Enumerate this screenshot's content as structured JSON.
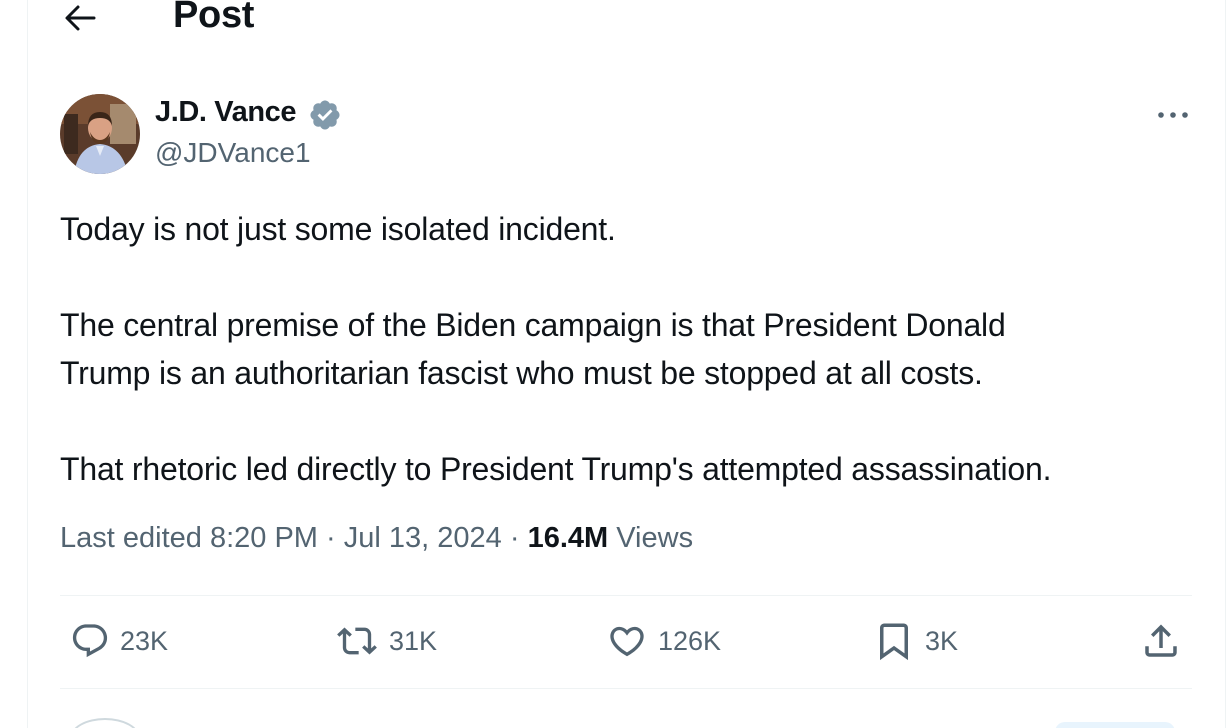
{
  "header": {
    "title": "Post",
    "back_icon": "arrow-left-icon"
  },
  "post": {
    "author": {
      "name": "J.D. Vance",
      "handle": "@JDVance1",
      "verified": true,
      "verified_color": "#829aab"
    },
    "text": {
      "line1": "Today is not just some isolated incident.",
      "line2": "The central premise of the Biden campaign is that President Donald",
      "line3": "Trump is an authoritarian fascist who must be stopped at all costs.",
      "line4": "That rhetoric led directly to President Trump's attempted assassination."
    },
    "meta": {
      "edited_label": "Last edited",
      "time": "8:20 PM",
      "separator": "·",
      "date": "Jul 13, 2024",
      "views_count": "16.4M",
      "views_label": "Views"
    },
    "actions": {
      "replies": "23K",
      "reposts": "31K",
      "likes": "126K",
      "bookmarks": "3K"
    }
  },
  "colors": {
    "text_primary": "#0f1419",
    "text_secondary": "#536471",
    "divider": "#eff3f4"
  }
}
